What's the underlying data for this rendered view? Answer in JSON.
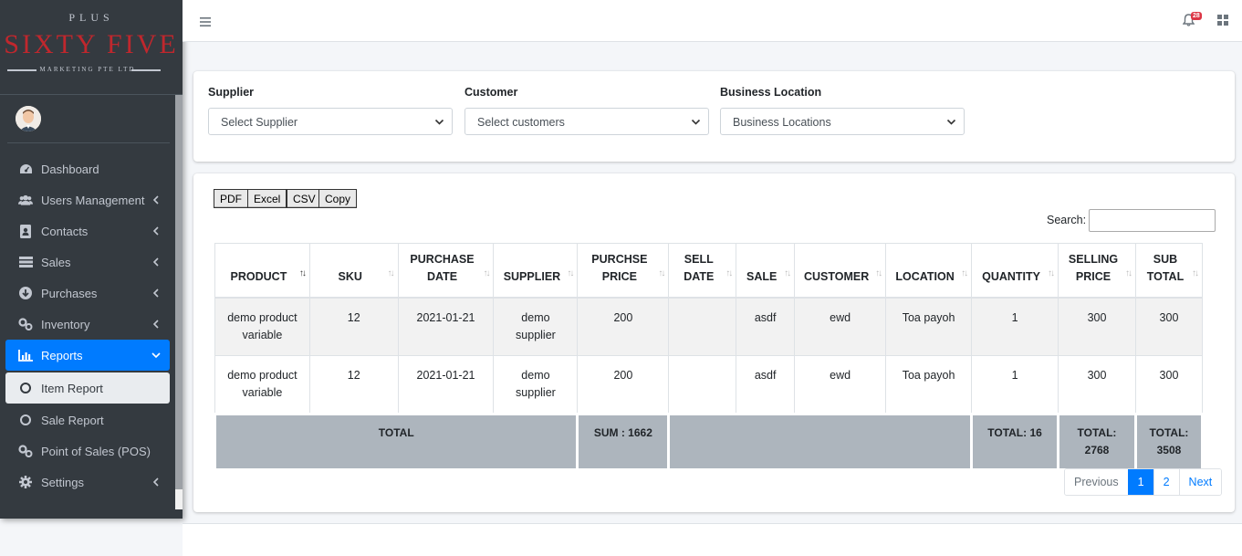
{
  "brand": {
    "top": "PLUS",
    "name": "SIXTY FIVE",
    "sub": "MARKETING PTE LTD"
  },
  "sidebar": {
    "items": [
      {
        "label": "Dashboard",
        "icon": "dashboard-icon"
      },
      {
        "label": "Users Management",
        "icon": "users-icon"
      },
      {
        "label": "Contacts",
        "icon": "contacts-icon"
      },
      {
        "label": "Sales",
        "icon": "sales-icon"
      },
      {
        "label": "Purchases",
        "icon": "purchases-icon"
      },
      {
        "label": "Inventory",
        "icon": "inventory-icon"
      },
      {
        "label": "Reports",
        "icon": "reports-icon"
      },
      {
        "label": "Item Report",
        "icon": "circle-icon"
      },
      {
        "label": "Sale Report",
        "icon": "circle-icon"
      },
      {
        "label": "Point of Sales (POS)",
        "icon": "pos-icon"
      },
      {
        "label": "Settings",
        "icon": "gear-icon"
      }
    ]
  },
  "topbar": {
    "notification_count": "28"
  },
  "filters": {
    "supplier_label": "Supplier",
    "supplier_value": "Select Supplier",
    "customer_label": "Customer",
    "customer_value": "Select customers",
    "location_label": "Business Location",
    "location_value": "Business Locations"
  },
  "export": {
    "pdf": "PDF",
    "excel": "Excel",
    "csv": "CSV",
    "copy": "Copy"
  },
  "search": {
    "label": "Search:"
  },
  "table": {
    "headers": {
      "product": "PRODUCT",
      "sku": "SKU",
      "purchase_date_1": "PURCHASE",
      "purchase_date_2": "DATE",
      "supplier": "SUPPLIER",
      "purchase_price_1": "PURCHSE",
      "purchase_price_2": "PRICE",
      "sell_date_1": "SELL",
      "sell_date_2": "DATE",
      "sale": "SALE",
      "customer": "CUSTOMER",
      "location": "LOCATION",
      "quantity": "QUANTITY",
      "selling_price_1": "SELLING",
      "selling_price_2": "PRICE",
      "sub_total_1": "SUB",
      "sub_total_2": "TOTAL"
    },
    "rows": [
      {
        "product_1": "demo product",
        "product_2": "variable",
        "sku": "12",
        "purchase_date": "2021-01-21",
        "supplier_1": "demo",
        "supplier_2": "supplier",
        "purchase_price": "200",
        "sell_date": "",
        "sale": "asdf",
        "customer": "ewd",
        "location": "Toa payoh",
        "quantity": "1",
        "selling_price": "300",
        "sub_total": "300"
      },
      {
        "product_1": "demo product",
        "product_2": "variable",
        "sku": "12",
        "purchase_date": "2021-01-21",
        "supplier_1": "demo",
        "supplier_2": "supplier",
        "purchase_price": "200",
        "sell_date": "",
        "sale": "asdf",
        "customer": "ewd",
        "location": "Toa payoh",
        "quantity": "1",
        "selling_price": "300",
        "sub_total": "300"
      }
    ],
    "footer": {
      "total_label": "TOTAL",
      "sum": "SUM :  1662",
      "total_qty": "TOTAL:  16",
      "total_selling_1": "TOTAL:",
      "total_selling_2": "2768",
      "total_sub": "TOTAL: 3508"
    }
  },
  "pagination": {
    "previous": "Previous",
    "pages": [
      "1",
      "2"
    ],
    "next": "Next"
  }
}
